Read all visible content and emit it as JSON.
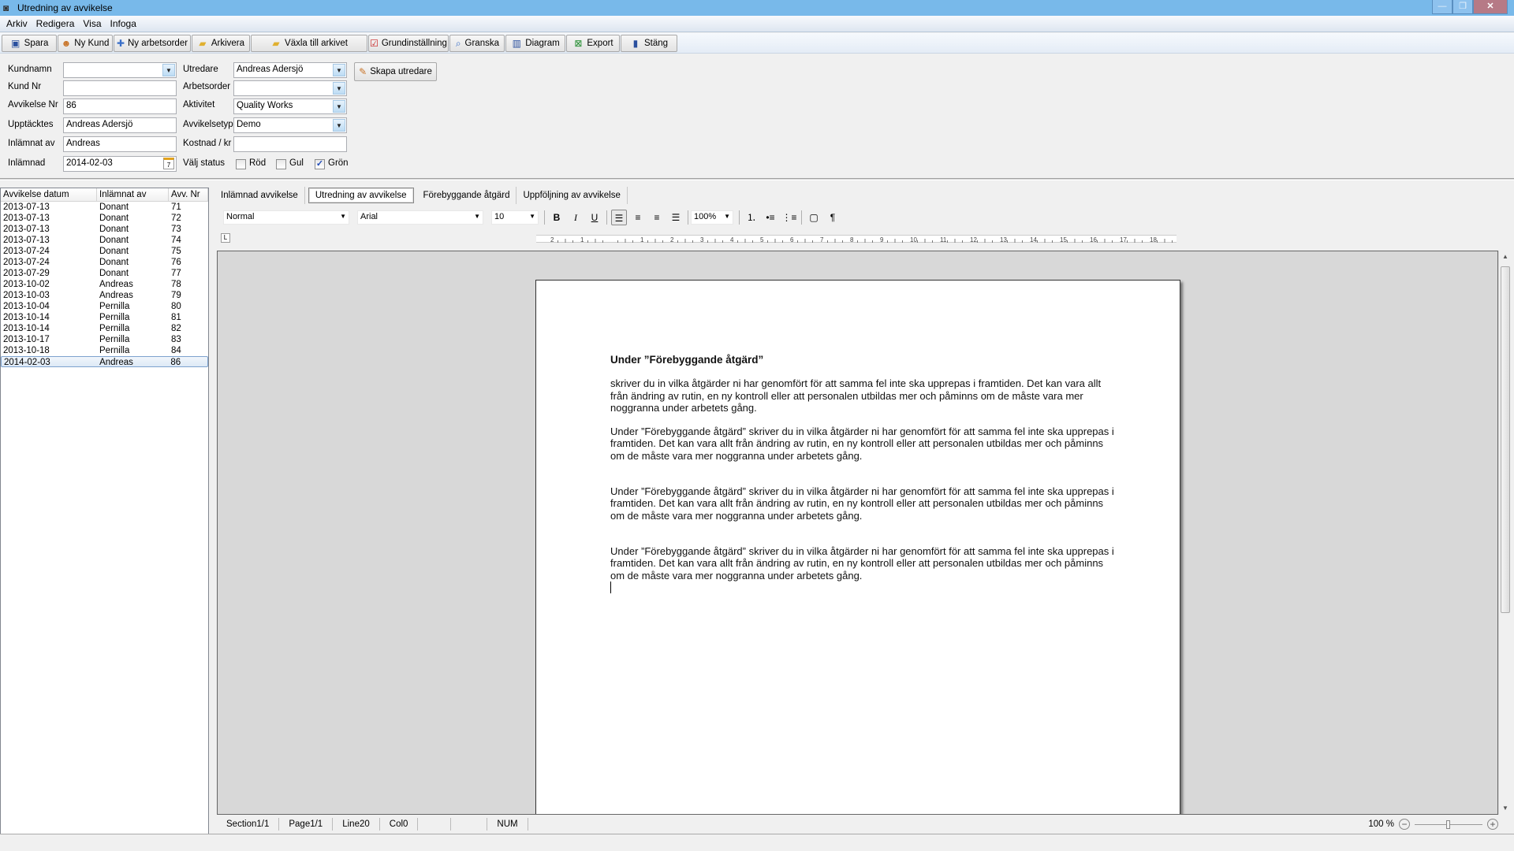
{
  "window": {
    "title": "Utredning av avvikelse",
    "minimize": "—",
    "restore": "❐",
    "close": "✕"
  },
  "menu": [
    "Arkiv",
    "Redigera",
    "Visa",
    "Infoga"
  ],
  "toolbar": [
    {
      "label": "Spara",
      "icon": "save-icon",
      "glyph": "💾",
      "color": "#2a4f9e"
    },
    {
      "label": "Ny Kund",
      "icon": "people-icon",
      "glyph": "👥",
      "color": "#c87428"
    },
    {
      "label": "Ny arbetsorder",
      "icon": "plus-icon",
      "glyph": "✚",
      "color": "#3a6fc8"
    },
    {
      "label": "Arkivera",
      "icon": "folder-icon",
      "glyph": "📁",
      "color": "#e0b030"
    },
    {
      "label": "Växla till arkivet",
      "icon": "folder-icon",
      "glyph": "📁",
      "color": "#e0b030"
    },
    {
      "label": "Grundinställning",
      "icon": "checklist-icon",
      "glyph": "☑",
      "color": "#c82020"
    },
    {
      "label": "Granska",
      "icon": "preview-icon",
      "glyph": "🔍",
      "color": "#3a6fc8"
    },
    {
      "label": "Diagram",
      "icon": "chart-icon",
      "glyph": "▥",
      "color": "#2a4f9e"
    },
    {
      "label": "Export",
      "icon": "excel-icon",
      "glyph": "⊠",
      "color": "#1d8a2a"
    },
    {
      "label": "Stäng",
      "icon": "door-icon",
      "glyph": "▮",
      "color": "#2a4f9e"
    }
  ],
  "form": {
    "kundnamn": {
      "label": "Kundnamn",
      "value": ""
    },
    "kund_nr": {
      "label": "Kund Nr",
      "value": ""
    },
    "avvikelse_nr": {
      "label": "Avvikelse Nr",
      "value": "86"
    },
    "upptacktes": {
      "label": "Upptäcktes",
      "value": "Andreas Adersjö"
    },
    "inlamnat_av": {
      "label": "Inlämnat av",
      "value": "Andreas"
    },
    "inlamnad": {
      "label": "Inlämnad",
      "value": "2014-02-03"
    },
    "utredare": {
      "label": "Utredare",
      "value": "Andreas Adersjö"
    },
    "arbetsorder": {
      "label": "Arbetsorder",
      "value": ""
    },
    "aktivitet": {
      "label": "Aktivitet",
      "value": "Quality Works"
    },
    "avvikelsetyp": {
      "label": "Avvikelsetyp",
      "value": "Demo"
    },
    "kostnad": {
      "label": "Kostnad / kr",
      "value": ""
    },
    "status": {
      "label": "Välj status",
      "options": [
        {
          "label": "Röd",
          "checked": false
        },
        {
          "label": "Gul",
          "checked": false
        },
        {
          "label": "Grön",
          "checked": true
        }
      ]
    },
    "skapa_utredare": "Skapa utredare"
  },
  "list": {
    "headers": [
      "Avvikelse datum",
      "Inlämnat av",
      "Avv. Nr"
    ],
    "rows": [
      [
        "2013-07-13",
        "Donant",
        "71"
      ],
      [
        "2013-07-13",
        "Donant",
        "72"
      ],
      [
        "2013-07-13",
        "Donant",
        "73"
      ],
      [
        "2013-07-13",
        "Donant",
        "74"
      ],
      [
        "2013-07-24",
        "Donant",
        "75"
      ],
      [
        "2013-07-24",
        "Donant",
        "76"
      ],
      [
        "2013-07-29",
        "Donant",
        "77"
      ],
      [
        "2013-10-02",
        "Andreas",
        "78"
      ],
      [
        "2013-10-03",
        "Andreas",
        "79"
      ],
      [
        "2013-10-04",
        "Pernilla",
        "80"
      ],
      [
        "2013-10-14",
        "Pernilla",
        "81"
      ],
      [
        "2013-10-14",
        "Pernilla",
        "82"
      ],
      [
        "2013-10-17",
        "Pernilla",
        "83"
      ],
      [
        "2013-10-18",
        "Pernilla",
        "84"
      ],
      [
        "2014-02-03",
        "Andreas",
        "86"
      ]
    ],
    "selected_index": 14
  },
  "tabs": [
    {
      "label": "Inlämnad avvikelse",
      "active": false
    },
    {
      "label": "Utredning av avvikelse",
      "active": true
    },
    {
      "label": "Förebyggande åtgärd",
      "active": false
    },
    {
      "label": "Uppföljning av avvikelse",
      "active": false
    }
  ],
  "format": {
    "style": "Normal",
    "font": "Arial",
    "size": "10",
    "zoom": "100%",
    "bold": "B",
    "italic": "I",
    "underline": "U",
    "pilcrow": "¶"
  },
  "ruler_labels": [
    "2",
    "1",
    "",
    "1",
    "2",
    "3",
    "4",
    "5",
    "6",
    "7",
    "8",
    "9",
    "10",
    "11",
    "12",
    "13",
    "14",
    "15",
    "16",
    "17",
    "18"
  ],
  "document": {
    "heading": "Under ”Förebyggande åtgärd”",
    "paragraphs": [
      " skriver du in vilka åtgärder ni har genomfört för att samma fel inte ska upprepas i framtiden. Det kan vara allt från ändring av rutin, en ny kontroll eller att personalen utbildas mer och påminns om de måste vara mer noggranna under arbetets gång.",
      "Under ”Förebyggande åtgärd” skriver du in vilka åtgärder ni har genomfört för att samma fel inte ska upprepas i framtiden. Det kan vara allt från ändring av rutin, en ny kontroll eller att personalen utbildas mer och påminns om de måste vara mer noggranna under arbetets gång.",
      "Under ”Förebyggande åtgärd” skriver du in vilka åtgärder ni har genomfört för att samma fel inte ska upprepas i framtiden. Det kan vara allt från ändring av rutin, en ny kontroll eller att personalen utbildas mer och påminns om de måste vara mer noggranna under arbetets gång.",
      "Under ”Förebyggande åtgärd” skriver du in vilka åtgärder ni har genomfört för att samma fel inte ska upprepas i framtiden. Det kan vara allt från ändring av rutin, en ny kontroll eller att personalen utbildas mer och påminns om de måste vara mer noggranna under arbetets gång."
    ]
  },
  "statusbar": {
    "section": "Section1/1",
    "page": "Page1/1",
    "line": "Line20",
    "col": "Col0",
    "empty1": "",
    "empty2": "",
    "num": "NUM",
    "zoom": "100 %",
    "zoom_level_percent": 100
  }
}
